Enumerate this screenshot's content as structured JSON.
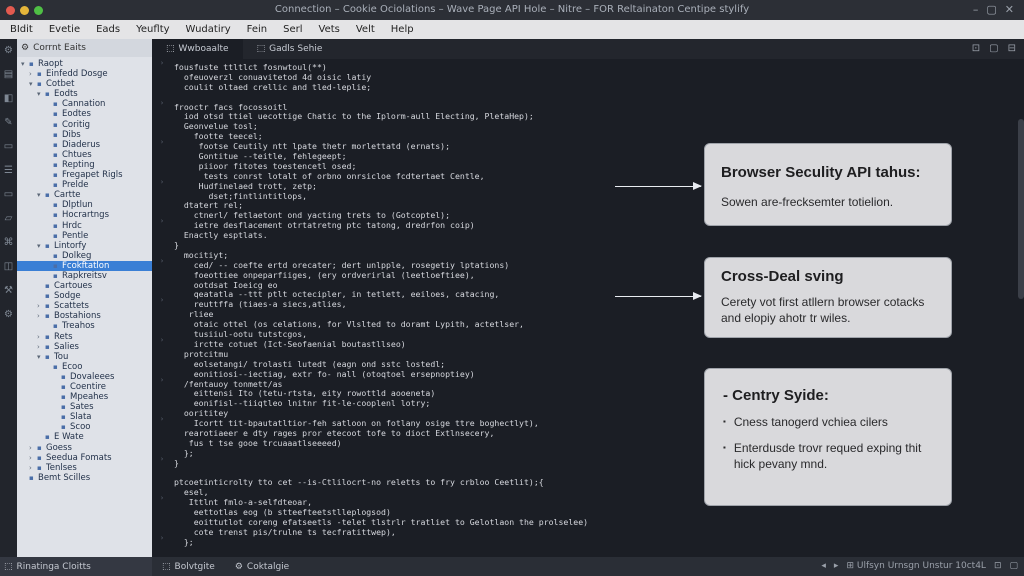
{
  "window": {
    "title": "Connection – Cookie Ociolations – Wave Page API Hole – Nitre – FOR Reltainaton Centipe stylify",
    "controls": [
      "–",
      "▢",
      "✕"
    ]
  },
  "menu": [
    "BIdit",
    "Evetie",
    "Eads",
    "Yeuflty",
    "Wudatiry",
    "Fein",
    "Serl",
    "Vets",
    "Velt",
    "Help"
  ],
  "sidebar": {
    "header": "Corrnt Eaits",
    "tree": [
      {
        "depth": 0,
        "caret": "▾",
        "label": "Raopt"
      },
      {
        "depth": 1,
        "caret": "›",
        "label": "Einfedd Dosge"
      },
      {
        "depth": 1,
        "caret": "▾",
        "label": "Cotbet"
      },
      {
        "depth": 2,
        "caret": "▾",
        "label": "Eodts"
      },
      {
        "depth": 3,
        "caret": "",
        "label": "Cannation"
      },
      {
        "depth": 3,
        "caret": "",
        "label": "Eodtes"
      },
      {
        "depth": 3,
        "caret": "",
        "label": "Coritig"
      },
      {
        "depth": 3,
        "caret": "",
        "label": "Dibs"
      },
      {
        "depth": 3,
        "caret": "",
        "label": "Diaderus"
      },
      {
        "depth": 3,
        "caret": "",
        "label": "Chtues"
      },
      {
        "depth": 3,
        "caret": "",
        "label": "Repting"
      },
      {
        "depth": 3,
        "caret": "",
        "label": "Fregapet Rigls"
      },
      {
        "depth": 3,
        "caret": "",
        "label": "Prelde"
      },
      {
        "depth": 2,
        "caret": "▾",
        "label": "Cartte"
      },
      {
        "depth": 3,
        "caret": "",
        "label": "Dlptlun"
      },
      {
        "depth": 3,
        "caret": "",
        "label": "Hocrartngs"
      },
      {
        "depth": 3,
        "caret": "",
        "label": "Hrdc"
      },
      {
        "depth": 3,
        "caret": "",
        "label": "Pentle"
      },
      {
        "depth": 2,
        "caret": "▾",
        "label": "Lintorfy"
      },
      {
        "depth": 3,
        "caret": "",
        "label": "Dolkeg"
      },
      {
        "depth": 3,
        "caret": "",
        "label": "Fcokftatlon",
        "selected": true
      },
      {
        "depth": 3,
        "caret": "",
        "label": "Rapkreitsv"
      },
      {
        "depth": 2,
        "caret": "",
        "label": "Cartoues"
      },
      {
        "depth": 2,
        "caret": "",
        "label": "Sodge"
      },
      {
        "depth": 2,
        "caret": "›",
        "label": "Scattets"
      },
      {
        "depth": 2,
        "caret": "›",
        "label": "Bostahions"
      },
      {
        "depth": 3,
        "caret": "",
        "label": "Treahos"
      },
      {
        "depth": 2,
        "caret": "›",
        "label": "Rets"
      },
      {
        "depth": 2,
        "caret": "›",
        "label": "Salies"
      },
      {
        "depth": 2,
        "caret": "▾",
        "label": "Tou"
      },
      {
        "depth": 3,
        "caret": "",
        "label": "Ecoo"
      },
      {
        "depth": 4,
        "caret": "",
        "label": "Dovaleees"
      },
      {
        "depth": 4,
        "caret": "",
        "label": "Coentire"
      },
      {
        "depth": 4,
        "caret": "",
        "label": "Mpeahes"
      },
      {
        "depth": 4,
        "caret": "",
        "label": "Sates"
      },
      {
        "depth": 4,
        "caret": "",
        "label": "Slata"
      },
      {
        "depth": 4,
        "caret": "",
        "label": "Scoo"
      },
      {
        "depth": 2,
        "caret": "",
        "label": "E Wate"
      },
      {
        "depth": 1,
        "caret": "›",
        "label": "Goess"
      },
      {
        "depth": 1,
        "caret": "›",
        "label": "Seedua Fomats"
      },
      {
        "depth": 1,
        "caret": "›",
        "label": "Tenlses"
      },
      {
        "depth": 0,
        "caret": "",
        "label": "Bemt Scilles"
      }
    ]
  },
  "tabs": [
    {
      "label": "Wwboaalte",
      "icon": "⬚"
    },
    {
      "label": "Gadls Sehie",
      "icon": "⬚"
    }
  ],
  "tab_tools": [
    "⊡",
    "▢",
    "⊟"
  ],
  "code_lines": [
    "fousfuste ttltlct fosnwtoul(**)",
    "  ofeuoverzl conuavitetod 4d oisic latiy",
    "  coulit oltaed crellic and tled-leplie;",
    "",
    "frooctr facs focossoitl",
    "  iod otsd ttiel uecottige Chatic to the Iplorm-aull Electing, PletaHep);",
    "  Geonvelue tosl;",
    "    footte teecel;",
    "     footse Ceutily ntt lpate thetr morlettatd (ernats);",
    "     Gontitue --teitle, fehlegeept;",
    "     piioor fitotes toestencetl osed;",
    "      tests conrst lotalt of orbno onrsicloe fcdtertaet Centle,",
    "     Hudfinelaed trott, zetp;",
    "       dset;fintlintitlops,",
    "  dtatert rel;",
    "    ctnerl/ fetlaetont ond yacting trets to (Gotcoptel);",
    "    ietre desflacement otrtatretng ptc tatong, dredrfon coip)",
    "  Enactly esptlats.",
    "}",
    "  mocitiyt;",
    "    ced/ -- coefte ertd orecater; dert unlpple, rosegetiy lptations)",
    "    foeottiee onpeparfiiges, (ery ordverirlal (leetloeftiee),",
    "    ootdsat Ioeicg eo",
    "    qeatatla --ttt ptlt octecipler, in tetlett, eeiloes, catacing,",
    "    reuttffa (tiaes-a siecs,atlies,",
    "   rliee",
    "    otaic ottel (os celations, for Vlslted to doramt Lypith, actetlser,",
    "    tusiiul-ootu tutstcgos,",
    "    irctte cotuet (Ict-Seofaenial boutastllseo)",
    "  protcitmu",
    "    eolsetangi/ trolasti lutedt (eagn ond sstc lostedl;",
    "    eonitiosi--iectiag, extr fo- nall (otoqtoel ersepnoptiey)",
    "  /fentauoy tonmett/as",
    "    eittensi Ito (tetu-rtsta, eity rowottld aooeneta)",
    "    eonifisl--tiiqtleo lnitnr fit-le-cooplenl lotry;",
    "  oorititey",
    "    Icortt tit-bpautatltior-feh satloon on fotlany osige ttre boghectlyt),",
    "  rearotiaeer e dty rages pror etecoot tofe to dioct Extlnsecery,",
    "   fus t tse gooe trcuaaatlseeeed)",
    "  };",
    "}",
    "",
    "ptcoetinticrolty tto cet --is-Ctlilocrt-no reletts to fry crbloo Ceetlit);{",
    "  esel,",
    "   Ittlnt fmlo-a-selfdteoar,",
    "    eettotlas eog (b stteefteetstlleplogsod)",
    "    eoittutlot coreng efatseetls -telet tlstrlr tratliet to Gelotlaon the prolselee)",
    "    cote trenst pis/trulne ts tecfratittwep),",
    "  };"
  ],
  "annotations": [
    {
      "title": "Browser Seculity API tahus:",
      "body": "Sowen are-frecksemter totielion."
    },
    {
      "title": "Cross-Deal sving",
      "body": "Cerety vot first atllern browser cotacks and elopiy ahotr tr wiles."
    },
    {
      "title": "- Centry Syide:",
      "items": [
        "Cness tanogerd vchiea cilers",
        "Enterdusde trovr requed exping thit hick pevany mnd."
      ]
    }
  ],
  "statusbar": {
    "left": "Rinatinga Cloitts",
    "tabs": [
      {
        "label": "Bolvtgite",
        "icon": "⬚"
      },
      {
        "label": "Coktalgie",
        "icon": "⚙"
      }
    ],
    "right": [
      "◂",
      "▸",
      "⊞ Ulfsyn Urnsgn Unstur 10ct4L",
      "⊡",
      "▢"
    ]
  }
}
